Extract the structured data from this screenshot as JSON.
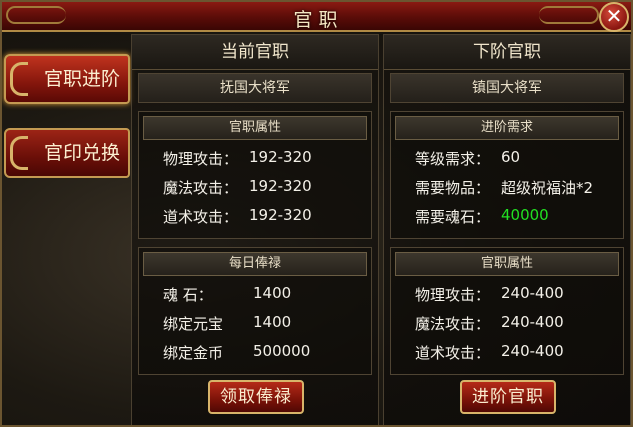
{
  "window": {
    "title": "官职",
    "close_symbol": "✕"
  },
  "sidebar": {
    "items": [
      {
        "label": "官职进阶",
        "active": true
      },
      {
        "label": "官印兑换",
        "active": false
      }
    ]
  },
  "current": {
    "header": "当前官职",
    "rank": "抚国大将军",
    "attributes": {
      "title": "官职属性",
      "rows": [
        {
          "label": "物理攻击：",
          "value": "192-320"
        },
        {
          "label": "魔法攻击：",
          "value": "192-320"
        },
        {
          "label": "道术攻击：",
          "value": "192-320"
        }
      ]
    },
    "salary": {
      "title": "每日俸禄",
      "rows": [
        {
          "label": "魂 石：",
          "value": "1400"
        },
        {
          "label": "绑定元宝",
          "value": "1400"
        },
        {
          "label": "绑定金币",
          "value": "500000"
        }
      ]
    },
    "button": "领取俸禄"
  },
  "next": {
    "header": "下阶官职",
    "rank": "镇国大将军",
    "requirements": {
      "title": "进阶需求",
      "rows": [
        {
          "label": "等级需求：",
          "value": "60"
        },
        {
          "label": "需要物品：",
          "value": "超级祝福油*2"
        },
        {
          "label": "需要魂石：",
          "value": "40000",
          "color": "#22e022"
        }
      ]
    },
    "attributes": {
      "title": "官职属性",
      "rows": [
        {
          "label": "物理攻击：",
          "value": "240-400"
        },
        {
          "label": "魔法攻击：",
          "value": "240-400"
        },
        {
          "label": "道术攻击：",
          "value": "240-400"
        }
      ]
    },
    "button": "进阶官职"
  }
}
